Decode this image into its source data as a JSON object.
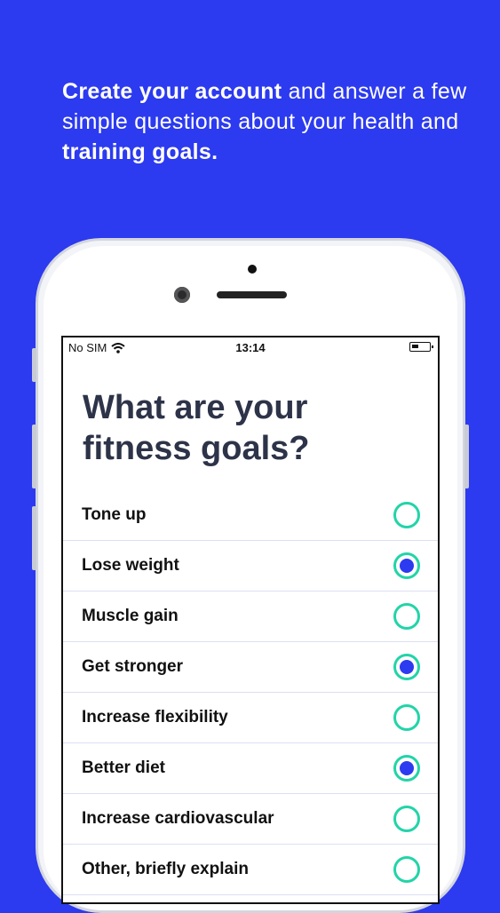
{
  "headline": {
    "bold1": "Create your account",
    "text1": " and answer a few simple questions about your health and ",
    "bold2": "training goals."
  },
  "status_bar": {
    "carrier": "No SIM",
    "time": "13:14"
  },
  "title": "What are your fitness goals?",
  "options": [
    {
      "label": "Tone up",
      "checked": false
    },
    {
      "label": "Lose weight",
      "checked": true
    },
    {
      "label": "Muscle gain",
      "checked": false
    },
    {
      "label": "Get stronger",
      "checked": true
    },
    {
      "label": "Increase flexibility",
      "checked": false
    },
    {
      "label": "Better diet",
      "checked": true
    },
    {
      "label": "Increase cardiovascular",
      "checked": false
    },
    {
      "label": "Other, briefly explain",
      "checked": false
    }
  ],
  "colors": {
    "background": "#2c3af0",
    "radio_ring": "#22d4a8",
    "radio_fill": "#2c3af0",
    "title": "#2d3348"
  }
}
